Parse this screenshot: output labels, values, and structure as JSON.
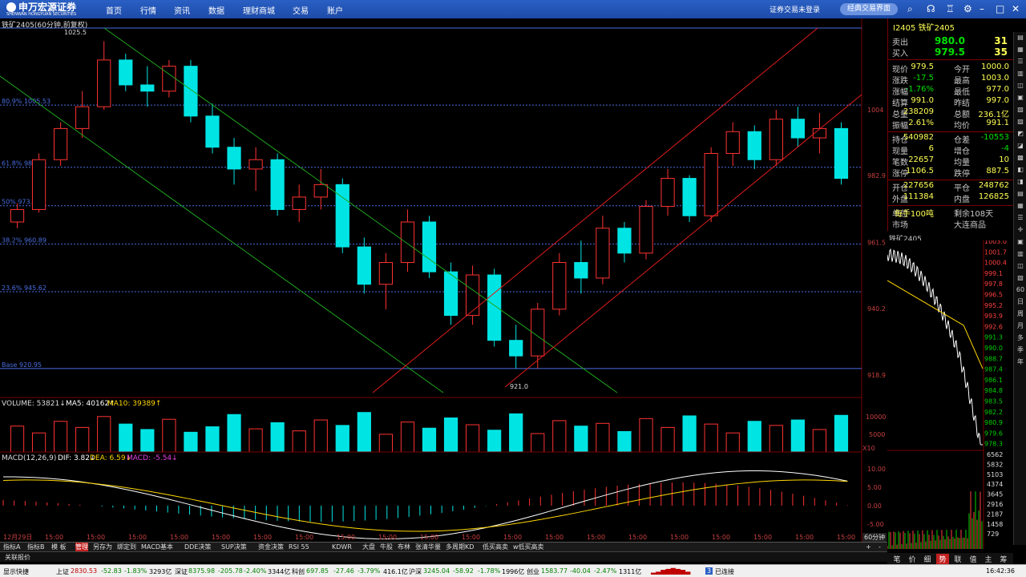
{
  "topbar": {
    "logo": "申万宏源证券",
    "logo_sub": "SHENWAN HONGYUAN SECURITIES",
    "nav": [
      "首页",
      "行情",
      "资讯",
      "数据",
      "理财商城",
      "交易",
      "账户"
    ],
    "login_status": "证券交易未登录",
    "classic_button": "经典交易界面",
    "icons": [
      "search-icon",
      "message-icon",
      "headset-icon",
      "shirt-icon",
      "gear-icon",
      "minimize-icon",
      "maximize-icon",
      "close-icon"
    ]
  },
  "chart": {
    "title": "铁矿2405(60分钟,前复权)",
    "price_ticks": [
      "1004",
      "982.9",
      "961.5",
      "940.2",
      "918.9"
    ],
    "fib": [
      "80.9% 1005.53",
      "61.8% 985.56",
      "50% 973.22",
      "38.2% 960.89",
      "23.6% 945.62",
      "Base 920.95"
    ],
    "high_label": "1025.5",
    "low_label": "921.0",
    "volume_legend": {
      "vol": "VOLUME: 53821↓",
      "ma5": "MA5: 40162↑",
      "ma10": "MA10: 39389↑"
    },
    "volume_ticks": [
      "10000",
      "5000",
      "X10"
    ],
    "macd_legend": {
      "name": "MACD(12,26,9)",
      "dif": "DIF: 3.82↓",
      "dea": "DEA: 6.59↓",
      "macd": "MACD: -5.54↓"
    },
    "macd_ticks": [
      "10.00",
      "5.00",
      "0.00",
      "-5.00"
    ],
    "time_labels": [
      "12月29日",
      "15:00",
      "15:00",
      "15:00",
      "15:00",
      "15:00",
      "15:00",
      "15:00",
      "15:00",
      "15:00",
      "15:00",
      "15:00",
      "15:00",
      "15:00",
      "15:00",
      "15:00",
      "15:00",
      "15:00",
      "15:00",
      "15:00",
      "15:00"
    ],
    "period_label": "60分钟",
    "colors": {
      "up": "#ff3232",
      "down": "#00e4e4",
      "fib": "#4a6ee0",
      "green_channel": "#1ea81e",
      "red_channel": "#e01c1c"
    }
  },
  "chart_data": {
    "type": "candlestick",
    "series": [
      {
        "name": "铁矿2405",
        "values": [
          {
            "o": 968,
            "h": 974,
            "l": 966,
            "c": 972
          },
          {
            "o": 972,
            "h": 990,
            "l": 971,
            "c": 988
          },
          {
            "o": 988,
            "h": 1000,
            "l": 986,
            "c": 998
          },
          {
            "o": 998,
            "h": 1010,
            "l": 995,
            "c": 1005
          },
          {
            "o": 1005,
            "h": 1026,
            "l": 1004,
            "c": 1020
          },
          {
            "o": 1020,
            "h": 1022,
            "l": 1010,
            "c": 1012
          },
          {
            "o": 1012,
            "h": 1018,
            "l": 1005,
            "c": 1010
          },
          {
            "o": 1010,
            "h": 1020,
            "l": 1008,
            "c": 1018
          },
          {
            "o": 1018,
            "h": 1020,
            "l": 1000,
            "c": 1002
          },
          {
            "o": 1002,
            "h": 1006,
            "l": 990,
            "c": 992
          },
          {
            "o": 992,
            "h": 995,
            "l": 980,
            "c": 985
          },
          {
            "o": 985,
            "h": 992,
            "l": 978,
            "c": 988
          },
          {
            "o": 988,
            "h": 990,
            "l": 970,
            "c": 972
          },
          {
            "o": 972,
            "h": 980,
            "l": 968,
            "c": 976
          },
          {
            "o": 976,
            "h": 985,
            "l": 972,
            "c": 980
          },
          {
            "o": 980,
            "h": 982,
            "l": 958,
            "c": 960
          },
          {
            "o": 960,
            "h": 963,
            "l": 945,
            "c": 948
          },
          {
            "o": 948,
            "h": 958,
            "l": 940,
            "c": 955
          },
          {
            "o": 955,
            "h": 972,
            "l": 952,
            "c": 968
          },
          {
            "o": 968,
            "h": 970,
            "l": 950,
            "c": 952
          },
          {
            "o": 952,
            "h": 955,
            "l": 935,
            "c": 938
          },
          {
            "o": 938,
            "h": 954,
            "l": 935,
            "c": 951
          },
          {
            "o": 951,
            "h": 953,
            "l": 928,
            "c": 930
          },
          {
            "o": 930,
            "h": 935,
            "l": 921,
            "c": 925
          },
          {
            "o": 925,
            "h": 942,
            "l": 921,
            "c": 940
          },
          {
            "o": 940,
            "h": 958,
            "l": 938,
            "c": 955
          },
          {
            "o": 955,
            "h": 962,
            "l": 945,
            "c": 950
          },
          {
            "o": 950,
            "h": 970,
            "l": 948,
            "c": 966
          },
          {
            "o": 966,
            "h": 968,
            "l": 955,
            "c": 958
          },
          {
            "o": 958,
            "h": 975,
            "l": 956,
            "c": 973
          },
          {
            "o": 973,
            "h": 985,
            "l": 970,
            "c": 982
          },
          {
            "o": 982,
            "h": 983,
            "l": 968,
            "c": 970
          },
          {
            "o": 970,
            "h": 992,
            "l": 968,
            "c": 990
          },
          {
            "o": 990,
            "h": 1000,
            "l": 986,
            "c": 997
          },
          {
            "o": 997,
            "h": 999,
            "l": 985,
            "c": 988
          },
          {
            "o": 988,
            "h": 1004,
            "l": 986,
            "c": 1001
          },
          {
            "o": 1001,
            "h": 1005,
            "l": 992,
            "c": 995
          },
          {
            "o": 995,
            "h": 1003,
            "l": 990,
            "c": 998
          },
          {
            "o": 998,
            "h": 1000,
            "l": 980,
            "c": 982
          }
        ]
      }
    ],
    "volume": [
      38000,
      28000,
      45000,
      36000,
      52000,
      41000,
      33000,
      48000,
      29000,
      37000,
      55000,
      34000,
      43000,
      31000,
      47000,
      39000,
      58000,
      26000,
      44000,
      35000,
      50000,
      40000,
      32000,
      56000,
      27000,
      46000,
      38000,
      42000,
      30000,
      49000,
      36000,
      53000,
      41000,
      28000,
      45000,
      39000,
      47000,
      33000,
      53821
    ],
    "macd": {
      "dif_end": 3.82,
      "dea_end": 6.59,
      "macd_end": -5.54
    },
    "yrange": [
      915,
      1030
    ],
    "macd_range": [
      -7,
      12
    ],
    "timeframe": "60分钟"
  },
  "quote": {
    "title": "I2405 铁矿2405",
    "sell": {
      "label": "卖出",
      "price": "980.0",
      "vol": "31"
    },
    "buy": {
      "label": "买入",
      "price": "979.5",
      "vol": "35"
    },
    "rows": [
      [
        "现价",
        "979.5",
        "今开",
        "1000.0"
      ],
      [
        "涨跌",
        "-17.5",
        "最高",
        "1003.0"
      ],
      [
        "涨幅",
        "-1.76%",
        "最低",
        "977.0"
      ],
      [
        "结算",
        "991.0",
        "昨结",
        "997.0"
      ],
      [
        "总量",
        "238209",
        "总额",
        "236.1亿"
      ],
      [
        "振幅",
        "2.61%",
        "均价",
        "991.1"
      ],
      [
        "持仓",
        "540982",
        "仓差",
        "-10553"
      ],
      [
        "现量",
        "6",
        "增仓",
        "-4"
      ],
      [
        "笔数",
        "22657",
        "均量",
        "10"
      ],
      [
        "涨停",
        "1106.5",
        "跌停",
        "887.5"
      ],
      [
        "开仓",
        "227656",
        "平仓",
        "248762"
      ],
      [
        "外盘",
        "111384",
        "内盘",
        "126825"
      ],
      [
        "单位",
        "每手100吨",
        "剩余108天",
        ""
      ],
      [
        "市场",
        "",
        "大连商品",
        ""
      ]
    ]
  },
  "mini": {
    "title": "铁矿2405",
    "price_ticks": [
      "1003.0",
      "1001.7",
      "1000.4",
      "999.1",
      "997.8",
      "996.5",
      "995.2",
      "993.9",
      "992.6",
      "991.3",
      "990.0",
      "988.7",
      "987.4",
      "986.1",
      "984.8",
      "983.5",
      "982.2",
      "980.9",
      "979.6",
      "978.3"
    ],
    "vol_ticks": [
      "6562",
      "5832",
      "5103",
      "4374",
      "3645",
      "2916",
      "2187",
      "1458",
      "729"
    ],
    "tabs": [
      "笔",
      "价",
      "细",
      "势",
      "联",
      "值",
      "主",
      "筹"
    ],
    "active_tab": "势"
  },
  "side_icons": [
    "60",
    "日",
    "周",
    "月",
    "多",
    "季",
    "年"
  ],
  "tabs": [
    "指标A",
    "指标B",
    "模 板",
    "管理",
    "另存为",
    "绑定到",
    "MACD基本",
    "DDE决策",
    "SUP决策",
    "资金决策",
    "RSI 55",
    "KDWR",
    "大盘",
    "牛股",
    "布林",
    "张清华量",
    "多周期KD",
    "低买高卖",
    "w低买高卖"
  ],
  "subtab": "关联报价",
  "status": {
    "quick": "显示快捷",
    "sh_label": "上证",
    "sh": "2830.53",
    "sh_chg": "-52.83",
    "sh_pct": "-1.83%",
    "sh_amt": "3293亿",
    "sz_label": "深证",
    "sz": "8375.98",
    "sz_chg": "-205.78",
    "sz_pct": "-2.40%",
    "sz_amt": "3344亿",
    "kc_label": "科创",
    "kc": "697.85",
    "kc_chg": "-27.46",
    "kc_pct": "-3.79%",
    "kc_amt": "416.1亿",
    "hs_label": "沪深",
    "hs": "3245.04",
    "hs_chg": "-58.92",
    "hs_pct": "-1.78%",
    "hs_amt": "1996亿",
    "cy_label": "创业",
    "cy": "1583.77",
    "cy_chg": "-40.04",
    "cy_pct": "-2.47%",
    "cy_amt": "1311亿",
    "conn": "已连接",
    "time": "16:42:36",
    "badge": "3"
  }
}
